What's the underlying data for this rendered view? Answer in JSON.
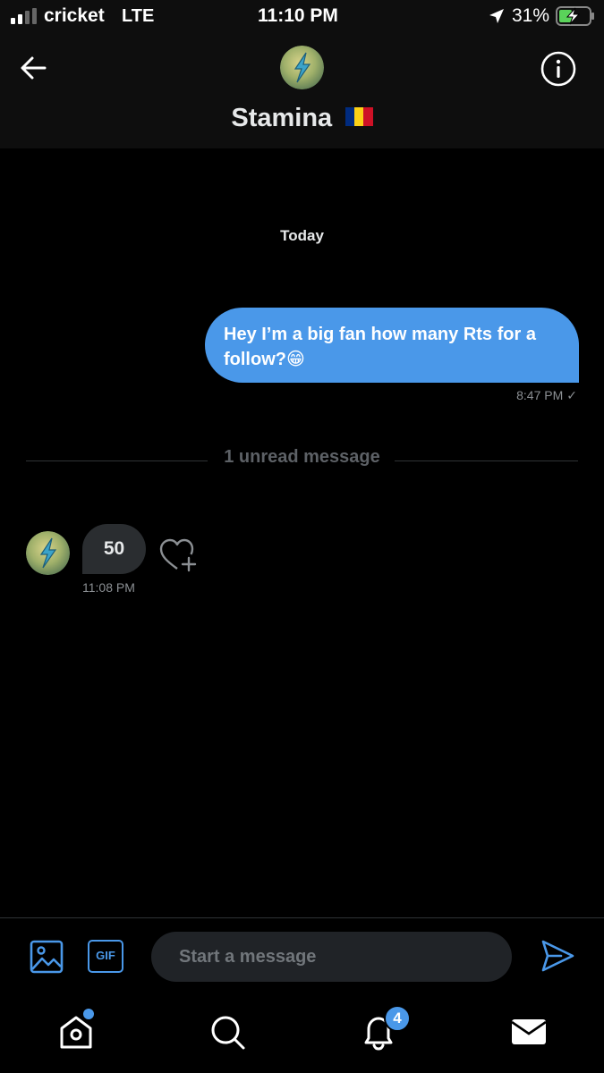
{
  "status_bar": {
    "carrier": "cricket",
    "network": "LTE",
    "time": "11:10 PM",
    "battery_percent": "31%",
    "charging": true
  },
  "header": {
    "name": "Stamina",
    "flag": "Romania",
    "flag_colors": [
      "#002b7f",
      "#fcd116",
      "#ce1126"
    ],
    "avatar_icon": "lightning-bolt-icon"
  },
  "conversation": {
    "day_label": "Today",
    "outgoing": {
      "text": "Hey I’m a big fan how many Rts for a follow?😁",
      "time": "8:47 PM",
      "status_icon": "check-icon"
    },
    "unread_divider": "1 unread message",
    "incoming": {
      "text": "50",
      "time": "11:08 PM"
    }
  },
  "composer": {
    "placeholder": "Start a message",
    "gif_label": "GIF"
  },
  "tabs": {
    "notification_count": "4"
  },
  "colors": {
    "accent": "#4a98e9",
    "background": "#000000",
    "bubble_in": "#2a2d30",
    "muted_text": "#8b8f93"
  }
}
